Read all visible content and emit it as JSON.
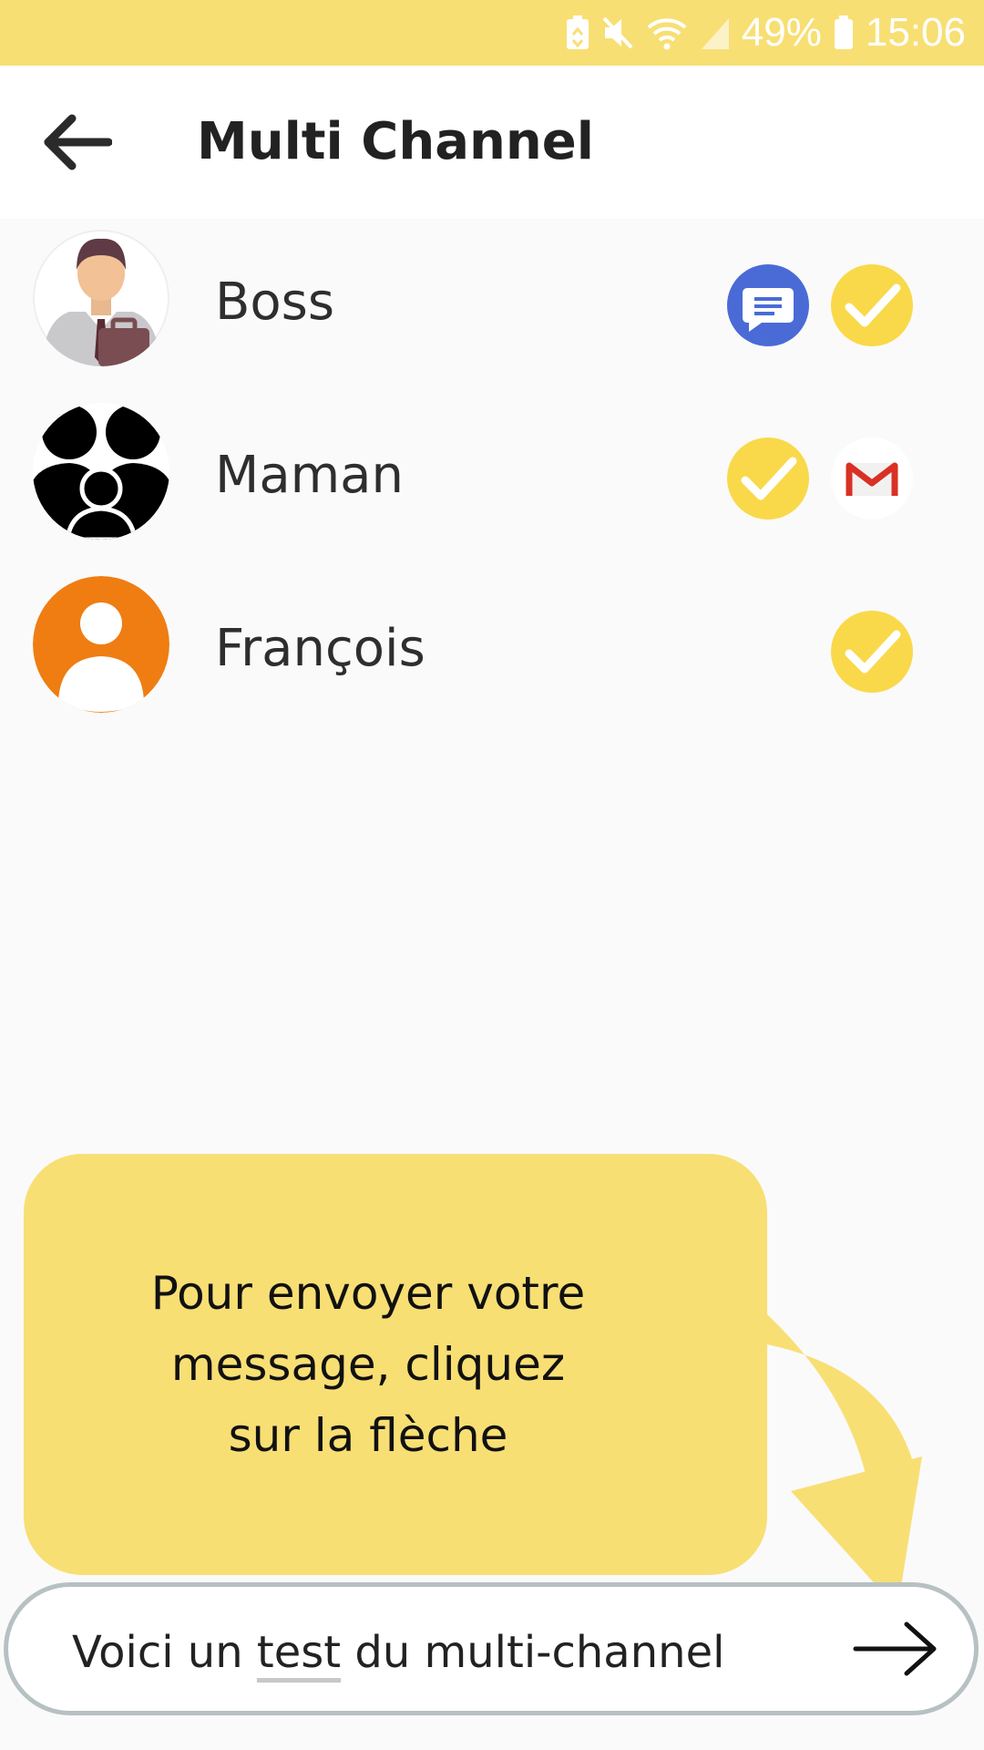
{
  "status_bar": {
    "battery_percent": "49%",
    "time": "15:06",
    "icons": [
      "battery-saver-icon",
      "mute-icon",
      "wifi-icon",
      "signal-icon",
      "battery-icon"
    ]
  },
  "header": {
    "title": "Multi Channel",
    "back_icon": "back-arrow-icon"
  },
  "contacts": [
    {
      "name": "Boss",
      "avatar": "businessman-avatar",
      "channels": [
        "sms-icon",
        "check-icon"
      ]
    },
    {
      "name": "Maman",
      "avatar": "group-avatar",
      "channels": [
        "check-icon",
        "gmail-icon"
      ]
    },
    {
      "name": "François",
      "avatar": "default-person-avatar",
      "channels": [
        "check-icon"
      ]
    }
  ],
  "tooltip": {
    "line1": "Pour envoyer votre",
    "line2": "message, cliquez",
    "line3": "sur la flèche"
  },
  "composer": {
    "text_before": "Voici un ",
    "text_underlined": "test",
    "text_after": " du multi-channel",
    "send_icon": "send-arrow-icon"
  },
  "colors": {
    "accent_yellow": "#f8df74",
    "check_yellow": "#f9d94a",
    "sms_blue": "#4a6bd6",
    "gmail_red": "#d93025",
    "avatar_orange": "#ef7d12",
    "input_border": "#b7c0c2"
  }
}
